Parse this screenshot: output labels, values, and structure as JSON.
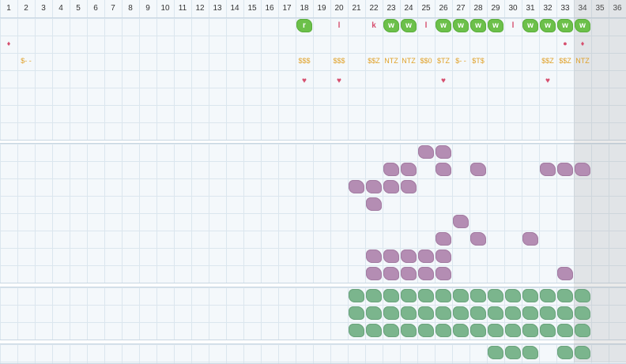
{
  "columns": [
    "1",
    "2",
    "3",
    "4",
    "5",
    "6",
    "7",
    "8",
    "9",
    "10",
    "11",
    "12",
    "13",
    "14",
    "15",
    "16",
    "17",
    "18",
    "19",
    "20",
    "21",
    "22",
    "23",
    "24",
    "25",
    "26",
    "27",
    "28",
    "29",
    "30",
    "31",
    "32",
    "33",
    "34",
    "35",
    "36"
  ],
  "colors": {
    "accent_green": "#6cc04a",
    "pink": "#d64f6e",
    "orange": "#e0a128",
    "purple_blob": "#b48db3",
    "green_blob": "#7bb58d",
    "grid_line": "#dbe6ee"
  },
  "top_badges": [
    {
      "col": 18,
      "text": "r",
      "kind": "badge"
    },
    {
      "col": 20,
      "text": "l",
      "kind": "glyph"
    },
    {
      "col": 22,
      "text": "k",
      "kind": "glyph"
    },
    {
      "col": 23,
      "text": "w",
      "kind": "badge"
    },
    {
      "col": 24,
      "text": "w",
      "kind": "badge"
    },
    {
      "col": 25,
      "text": "l",
      "kind": "glyph"
    },
    {
      "col": 26,
      "text": "w",
      "kind": "badge"
    },
    {
      "col": 27,
      "text": "w",
      "kind": "badge"
    },
    {
      "col": 28,
      "text": "w",
      "kind": "badge"
    },
    {
      "col": 29,
      "text": "w",
      "kind": "badge"
    },
    {
      "col": 30,
      "text": "l",
      "kind": "glyph"
    },
    {
      "col": 31,
      "text": "w",
      "kind": "badge"
    },
    {
      "col": 32,
      "text": "w",
      "kind": "badge"
    },
    {
      "col": 33,
      "text": "w",
      "kind": "badge"
    },
    {
      "col": 34,
      "text": "w",
      "kind": "badge"
    }
  ],
  "marker_row": [
    {
      "col": 1,
      "symbol": "♦"
    },
    {
      "col": 33,
      "symbol": "●"
    },
    {
      "col": 34,
      "symbol": "♦"
    }
  ],
  "currency_row": [
    {
      "col": 2,
      "text": "$- -"
    },
    {
      "col": 18,
      "text": "$$$"
    },
    {
      "col": 20,
      "text": "$$$"
    },
    {
      "col": 22,
      "text": "$$Z"
    },
    {
      "col": 23,
      "text": "NTZ"
    },
    {
      "col": 24,
      "text": "NTZ"
    },
    {
      "col": 25,
      "text": "$$0"
    },
    {
      "col": 26,
      "text": "$TZ"
    },
    {
      "col": 27,
      "text": "$- -"
    },
    {
      "col": 28,
      "text": "$T$"
    },
    {
      "col": 32,
      "text": "$$Z"
    },
    {
      "col": 33,
      "text": "$$Z"
    },
    {
      "col": 34,
      "text": "NTZ"
    }
  ],
  "hearts_row": [
    {
      "col": 18,
      "symbol": "♥"
    },
    {
      "col": 20,
      "symbol": "♥"
    },
    {
      "col": 26,
      "symbol": "♥"
    },
    {
      "col": 32,
      "symbol": "♥"
    }
  ],
  "purple_blobs": [
    {
      "row": 0,
      "cols": [
        25,
        26
      ]
    },
    {
      "row": 1,
      "cols": [
        23,
        24,
        26,
        28,
        32,
        33,
        34
      ]
    },
    {
      "row": 2,
      "cols": [
        21,
        22,
        23,
        24
      ]
    },
    {
      "row": 3,
      "cols": [
        22
      ]
    },
    {
      "row": 4,
      "cols": [
        27
      ]
    },
    {
      "row": 5,
      "cols": [
        26,
        28,
        31
      ]
    },
    {
      "row": 6,
      "cols": [
        22,
        23,
        24,
        25,
        26
      ]
    },
    {
      "row": 7,
      "cols": [
        22,
        23,
        24,
        25,
        26,
        33
      ]
    }
  ],
  "green_blobs": [
    {
      "row": 0,
      "from": 21,
      "to": 34
    },
    {
      "row": 1,
      "from": 21,
      "to": 34
    },
    {
      "row": 2,
      "from": 21,
      "to": 34
    }
  ],
  "bottom_green_blobs": [
    29,
    30,
    31,
    33,
    34
  ]
}
